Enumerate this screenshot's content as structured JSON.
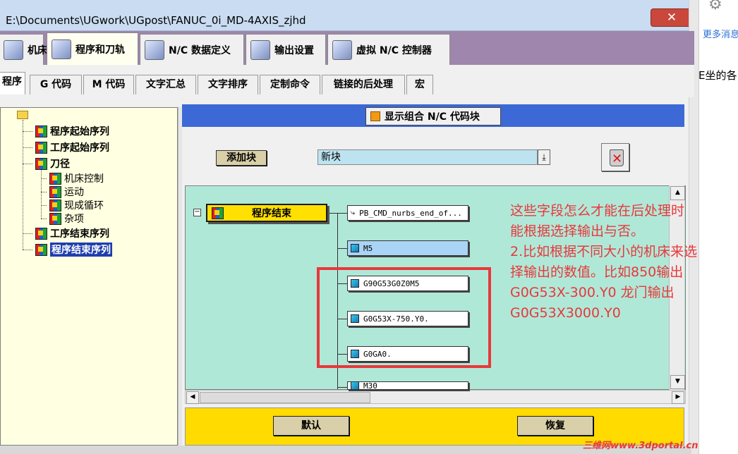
{
  "window": {
    "title": "E:\\Documents\\UGwork\\UGpost\\FANUC_0i_MD-4AXIS_zjhd",
    "close_glyph": "✕"
  },
  "side_panel": {
    "more_messages": "更多消息",
    "partial_text": "E坐的各"
  },
  "main_tabs": [
    {
      "label": "机床",
      "icon": "machine-tool-icon"
    },
    {
      "label": "程序和刀轨",
      "icon": "program-toolpath-icon",
      "active": true
    },
    {
      "label": "N/C 数据定义",
      "icon": "nc-data-icon"
    },
    {
      "label": "输出设置",
      "icon": "printer-icon"
    },
    {
      "label": "虚拟 N/C 控制器",
      "icon": "virtual-controller-icon"
    }
  ],
  "sub_tabs": [
    {
      "label": "程序",
      "active": true
    },
    {
      "label": "G 代码"
    },
    {
      "label": "M 代码"
    },
    {
      "label": "文字汇总"
    },
    {
      "label": "文字排序"
    },
    {
      "label": "定制命令"
    },
    {
      "label": "链接的后处理"
    },
    {
      "label": "宏"
    }
  ],
  "tree": {
    "items": [
      {
        "label": "程序起始序列"
      },
      {
        "label": "工序起始序列"
      },
      {
        "label": "刀径"
      },
      {
        "label": "机床控制"
      },
      {
        "label": "运动"
      },
      {
        "label": "现成循环"
      },
      {
        "label": "杂项"
      },
      {
        "label": "工序结束序列"
      },
      {
        "label": "程序结束序列",
        "selected": true
      }
    ]
  },
  "header": {
    "show_combined": "显示组合 N/C 代码块"
  },
  "toolbar": {
    "add_block": "添加块",
    "new_block_value": "新块",
    "dropdown_glyph": "⤓"
  },
  "canvas": {
    "main_block": "程序结束",
    "collapse_glyph": "−",
    "blocks": [
      {
        "text": "PB_CMD_nurbs_end_of...",
        "highlighted": false
      },
      {
        "text": "M5",
        "highlighted": true
      },
      {
        "text": "G90G53G0Z0M5",
        "highlighted": false
      },
      {
        "text": "G0G53X-750.Y0.",
        "highlighted": false
      },
      {
        "text": "G0GA0.",
        "highlighted": false
      },
      {
        "text": "M30",
        "highlighted": false
      }
    ]
  },
  "annotation": {
    "lines": [
      "这些字段怎么才能在后处理时",
      "能根据选择输出与否。",
      "2.比如根据不同大小的机床来选",
      "择输出的数值。比如850输出",
      "G0G53X-300.Y0     龙门输出",
      "G0G53X3000.Y0"
    ],
    "color": "#e8383a"
  },
  "bottom": {
    "default": "默认",
    "restore": "恢复"
  },
  "watermark": "三维网www.3dportal.cn"
}
